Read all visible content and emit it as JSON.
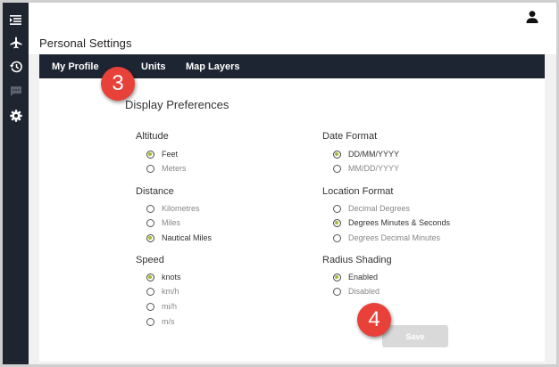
{
  "sidebar": {
    "icons": [
      "menu-list-icon",
      "airplane-icon",
      "history-icon",
      "chat-icon",
      "gear-icon"
    ]
  },
  "header": {
    "title": "Personal Settings",
    "user_icon": "user-icon"
  },
  "tabs": [
    {
      "label": "My Profile",
      "active": false
    },
    {
      "label": "Units",
      "active": true
    },
    {
      "label": "Map Layers",
      "active": false
    }
  ],
  "main": {
    "heading": "Display Preferences",
    "groups": {
      "altitude": {
        "label": "Altitude",
        "options": [
          {
            "label": "Feet",
            "selected": true
          },
          {
            "label": "Meters",
            "selected": false
          }
        ]
      },
      "distance": {
        "label": "Distance",
        "options": [
          {
            "label": "Kilometres",
            "selected": false
          },
          {
            "label": "Miles",
            "selected": false
          },
          {
            "label": "Nautical Miles",
            "selected": true
          }
        ]
      },
      "speed": {
        "label": "Speed",
        "options": [
          {
            "label": "knots",
            "selected": true
          },
          {
            "label": "km/h",
            "selected": false
          },
          {
            "label": "mi/h",
            "selected": false
          },
          {
            "label": "m/s",
            "selected": false
          }
        ]
      },
      "date_format": {
        "label": "Date Format",
        "options": [
          {
            "label": "DD/MM/YYYY",
            "selected": true
          },
          {
            "label": "MM/DD/YYYY",
            "selected": false
          }
        ]
      },
      "location_format": {
        "label": "Location Format",
        "options": [
          {
            "label": "Decimal Degrees",
            "selected": false
          },
          {
            "label": "Degrees Minutes & Seconds",
            "selected": true
          },
          {
            "label": "Degrees Decimal Minutes",
            "selected": false
          }
        ]
      },
      "radius_shading": {
        "label": "Radius Shading",
        "options": [
          {
            "label": "Enabled",
            "selected": true
          },
          {
            "label": "Disabled",
            "selected": false
          }
        ]
      }
    },
    "save_label": "Save"
  },
  "callouts": [
    "3",
    "4"
  ],
  "colors": {
    "sidebar": "#1f2530",
    "tabbar": "#1e2532",
    "accent": "#c9d44a",
    "radio_fill": "#a8b82a",
    "callout": "#e8413a",
    "save_disabled": "#d9d9d9"
  }
}
